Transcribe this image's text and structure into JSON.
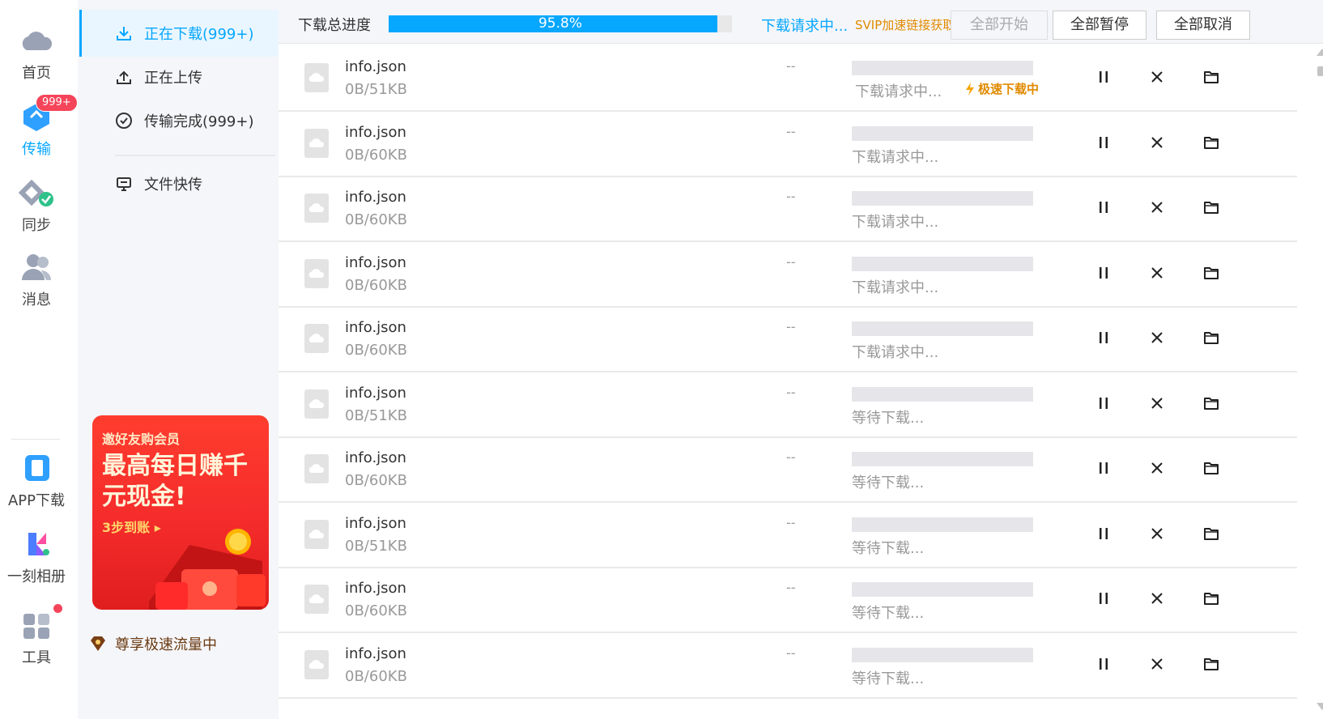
{
  "nav": {
    "home": "首页",
    "transfer": "传输",
    "transfer_badge": "999+",
    "sync": "同步",
    "message": "消息",
    "app_download": "APP下载",
    "album": "一刻相册",
    "tools": "工具"
  },
  "sidebar": {
    "downloading": "正在下载(999+)",
    "uploading": "正在上传",
    "completed": "传输完成(999+)",
    "quick_transfer": "文件快传",
    "promo": {
      "line1": "邀好友购会员",
      "line2": "最高每日赚千元现金!",
      "line3": "3步到账 ▸"
    },
    "vip_text": "尊享极速流量中"
  },
  "topbar": {
    "label": "下载总进度",
    "progress_percent": 95.8,
    "progress_text": "95.8%",
    "status": "下载请求中...",
    "svip": "SVIP加速链接获取中...",
    "start_all": "全部开始",
    "pause_all": "全部暂停",
    "cancel_all": "全部取消"
  },
  "rows": [
    {
      "name": "info.json",
      "size": "0B/51KB",
      "speed": "--",
      "status": "下载请求中...",
      "fast": "极速下载中"
    },
    {
      "name": "info.json",
      "size": "0B/60KB",
      "speed": "--",
      "status": "下载请求中..."
    },
    {
      "name": "info.json",
      "size": "0B/60KB",
      "speed": "--",
      "status": "下载请求中..."
    },
    {
      "name": "info.json",
      "size": "0B/60KB",
      "speed": "--",
      "status": "下载请求中..."
    },
    {
      "name": "info.json",
      "size": "0B/60KB",
      "speed": "--",
      "status": "下载请求中..."
    },
    {
      "name": "info.json",
      "size": "0B/51KB",
      "speed": "--",
      "status": "等待下载..."
    },
    {
      "name": "info.json",
      "size": "0B/60KB",
      "speed": "--",
      "status": "等待下载..."
    },
    {
      "name": "info.json",
      "size": "0B/51KB",
      "speed": "--",
      "status": "等待下载..."
    },
    {
      "name": "info.json",
      "size": "0B/60KB",
      "speed": "--",
      "status": "等待下载..."
    },
    {
      "name": "info.json",
      "size": "0B/60KB",
      "speed": "--",
      "status": "等待下载..."
    }
  ],
  "colors": {
    "accent": "#06a7ff",
    "orange": "#e08a00",
    "badge": "#f5455a"
  }
}
